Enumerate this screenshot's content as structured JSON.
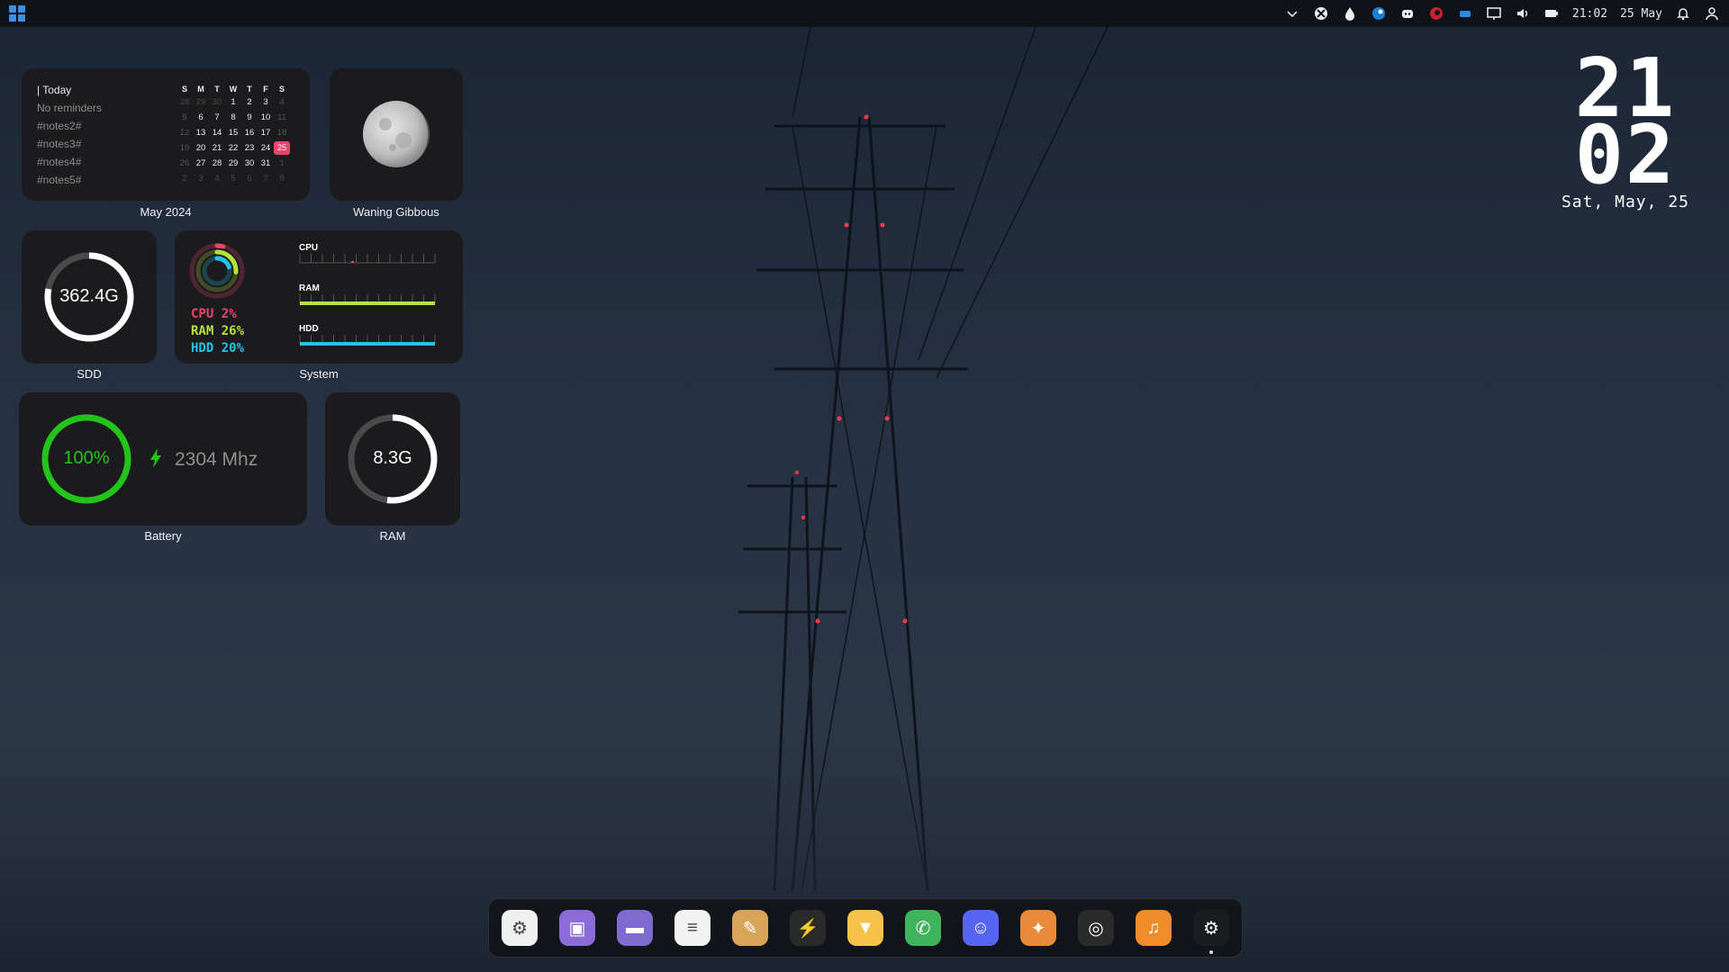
{
  "tray": {
    "time": "21:02",
    "date": "25 May",
    "icons": [
      "chevron-down-icon",
      "xbox-icon",
      "droplet-icon",
      "steam-tray-icon",
      "discord-tray-icon",
      "app-tray-icon",
      "teams-tray-icon",
      "display-icon",
      "volume-icon",
      "battery-icon",
      "bell-icon",
      "user-icon"
    ]
  },
  "calendar": {
    "today_label": "| Today",
    "reminders": [
      "No reminders",
      "#notes2#",
      "#notes3#",
      "#notes4#",
      "#notes5#"
    ],
    "weekdays": [
      "S",
      "M",
      "T",
      "W",
      "T",
      "F",
      "S"
    ],
    "weeks": [
      [
        "28",
        "29",
        "30",
        "1",
        "2",
        "3",
        "4"
      ],
      [
        "5",
        "6",
        "7",
        "8",
        "9",
        "10",
        "11"
      ],
      [
        "12",
        "13",
        "14",
        "15",
        "16",
        "17",
        "18"
      ],
      [
        "19",
        "20",
        "21",
        "22",
        "23",
        "24",
        "25"
      ],
      [
        "26",
        "27",
        "28",
        "29",
        "30",
        "31",
        "1"
      ],
      [
        "2",
        "3",
        "4",
        "5",
        "6",
        "7",
        "8"
      ]
    ],
    "selected_day": "25",
    "label": "May 2024"
  },
  "moon": {
    "label": "Waning Gibbous"
  },
  "ssd": {
    "value_text": "362.4G",
    "label": "SDD",
    "fill": 0.78
  },
  "system": {
    "label": "System",
    "cpu_text": "CPU 2%",
    "ram_text": "RAM 26%",
    "hdd_text": "HDD 20%",
    "cpu_title": "CPU",
    "ram_title": "RAM",
    "hdd_title": "HDD",
    "cpu": 0.02,
    "ram": 0.26,
    "hdd": 0.2,
    "colors": {
      "cpu": "#e8456b",
      "ram": "#b6e33a",
      "hdd": "#22c3ea"
    }
  },
  "battery": {
    "value_text": "100%",
    "freq_text": "2304 Mhz",
    "label": "Battery",
    "fill": 1.0,
    "color": "#22c41a"
  },
  "ram": {
    "value_text": "8.3G",
    "label": "RAM",
    "fill": 0.52
  },
  "clock": {
    "hour": "21",
    "minute": "02",
    "date": "Sat, May, 25"
  },
  "dock": {
    "apps": [
      {
        "name": "settings",
        "icon": "gear-icon",
        "color": "#f0f0f0",
        "glyph": "⚙"
      },
      {
        "name": "store",
        "icon": "store-bag-icon",
        "color": "#8b6cd6",
        "glyph": "▣"
      },
      {
        "name": "files",
        "icon": "folder-icon",
        "color": "#7e6bd0",
        "glyph": "▬"
      },
      {
        "name": "notes",
        "icon": "notepad-icon",
        "color": "#f2f2f2",
        "glyph": "≡"
      },
      {
        "name": "paint",
        "icon": "palette-icon",
        "color": "#d8a458",
        "glyph": "✎"
      },
      {
        "name": "terminal",
        "icon": "terminal-icon",
        "color": "#2a2a2a",
        "glyph": "⚡"
      },
      {
        "name": "brave",
        "icon": "brave-lion-icon",
        "color": "#f6c34a",
        "glyph": "▼"
      },
      {
        "name": "whatsapp",
        "icon": "whatsapp-icon",
        "color": "#3fb45c",
        "glyph": "✆"
      },
      {
        "name": "discord",
        "icon": "discord-icon",
        "color": "#5865f2",
        "glyph": "☺"
      },
      {
        "name": "gimp",
        "icon": "gimp-icon",
        "color": "#e88a3a",
        "glyph": "✦"
      },
      {
        "name": "obs",
        "icon": "obs-icon",
        "color": "#2b2b2b",
        "glyph": "◎"
      },
      {
        "name": "music",
        "icon": "headphones-icon",
        "color": "#f08c2a",
        "glyph": "♫"
      },
      {
        "name": "steam",
        "icon": "steam-icon",
        "color": "#1a1c20",
        "glyph": "⚙"
      }
    ]
  }
}
